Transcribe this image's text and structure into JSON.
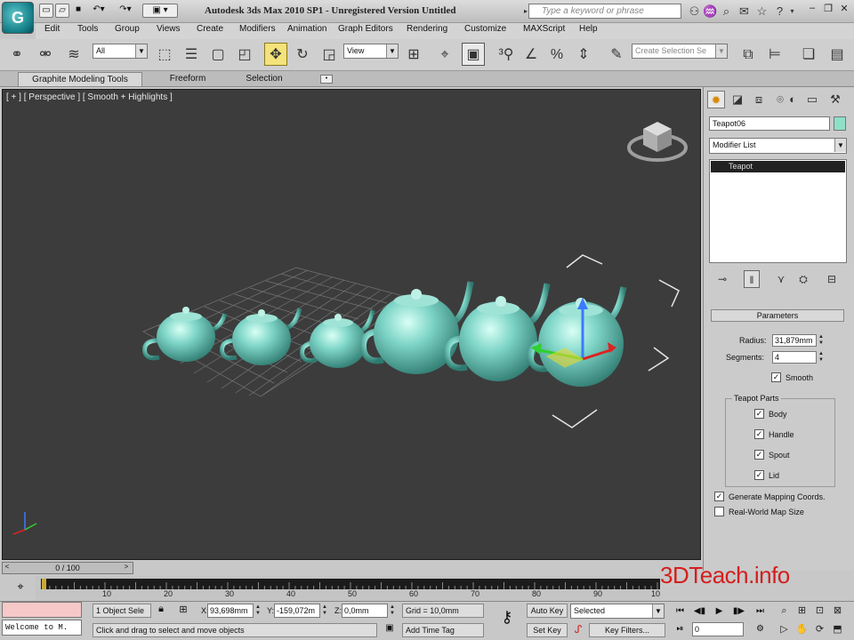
{
  "window": {
    "title": "Autodesk 3ds Max  2010 SP1  -  Unregistered Version    Untitled",
    "app_logo": "3ds Max logo",
    "search_placeholder": "Type a keyword or phrase",
    "controls": [
      "minimize",
      "restore",
      "close"
    ]
  },
  "quick_access": [
    "new-icon",
    "open-icon",
    "save-icon",
    "undo-icon",
    "redo-icon",
    "project-folder-icon"
  ],
  "menu": [
    "Edit",
    "Tools",
    "Group",
    "Views",
    "Create",
    "Modifiers",
    "Animation",
    "Graph Editors",
    "Rendering",
    "Customize",
    "MAXScript",
    "Help"
  ],
  "toolbar": {
    "selection_filter": "All",
    "reference_coord": "View",
    "named_selection_placeholder": "Create Selection Se"
  },
  "ribbon_tabs": [
    "Graphite Modeling Tools",
    "Freeform",
    "Selection"
  ],
  "viewport": {
    "label": "[ + ] [ Perspective ] [ Smooth + Highlights ]",
    "object_color": "#7fd6c8",
    "background": "#3c3c3c"
  },
  "command_panel": {
    "object_name": "Teapot06",
    "object_color": "#8fe0c8",
    "modifier_list": "Modifier List",
    "stack_item": "Teapot",
    "rollout_title": "Parameters",
    "radius_label": "Radius:",
    "radius_value": "31,879mm",
    "segments_label": "Segments:",
    "segments_value": "4",
    "smooth_label": "Smooth",
    "smooth_checked": true,
    "parts_title": "Teapot Parts",
    "parts": [
      {
        "label": "Body",
        "checked": true
      },
      {
        "label": "Handle",
        "checked": true
      },
      {
        "label": "Spout",
        "checked": true
      },
      {
        "label": "Lid",
        "checked": true
      }
    ],
    "gen_mapping_label": "Generate Mapping Coords.",
    "gen_mapping_checked": true,
    "real_world_label": "Real-World Map Size",
    "real_world_checked": false
  },
  "timeline": {
    "slider_text": "0 / 100",
    "ticks": [
      "10",
      "20",
      "30",
      "40",
      "50",
      "60",
      "70",
      "80",
      "90",
      "10"
    ]
  },
  "watermark": "3DTeach.info",
  "status": {
    "listener_text": "Welcome to M.",
    "selection_count": "1 Object Sele",
    "x_label": "X:",
    "x_value": "93,698mm",
    "y_label": "Y:",
    "y_value": "-159,072m",
    "z_label": "Z:",
    "z_value": "0,0mm",
    "grid": "Grid = 10,0mm",
    "prompt": "Click and drag to select and move objects",
    "add_time_tag": "Add Time Tag",
    "auto_key": "Auto Key",
    "key_mode": "Selected",
    "set_key": "Set Key",
    "key_filters": "Key Filters...",
    "current_frame": "0"
  }
}
